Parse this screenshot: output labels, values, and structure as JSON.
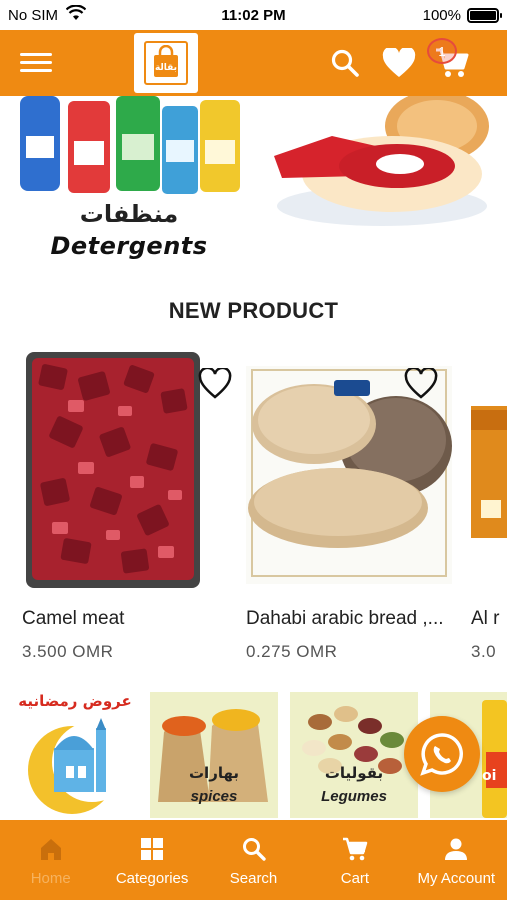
{
  "status_bar": {
    "carrier": "No SIM",
    "time": "11:02 PM",
    "battery": "100%",
    "battery_level": 1.0
  },
  "header": {
    "menu_icon": "hamburger-menu-icon",
    "search_icon": "search-icon",
    "favorites_icon": "heart-icon",
    "cart_icon": "cart-icon",
    "cart_count": "1"
  },
  "categories": [
    {
      "label_ar": "منظفات",
      "label_en": "Detergents"
    },
    {
      "label_ar": "",
      "label_en": ""
    }
  ],
  "section_title": "NEW PRODUCT",
  "products": [
    {
      "name": "Camel meat",
      "price": "3.500 OMR"
    },
    {
      "name": "Dahabi arabic bread ,...",
      "price": "0.275 OMR"
    },
    {
      "name": "Al r",
      "price": "3.0"
    }
  ],
  "offers": [
    {
      "label_ar": "عروض رمضانيه",
      "label_en": ""
    },
    {
      "label_ar": "بهارات",
      "label_en": "spices"
    },
    {
      "label_ar": "بقوليات",
      "label_en": "Legumes"
    },
    {
      "label_ar": "oi",
      "label_en": ""
    }
  ],
  "bottom_nav": [
    {
      "label": "Home",
      "icon": "home-icon",
      "active": true
    },
    {
      "label": "Categories",
      "icon": "grid-icon",
      "active": false
    },
    {
      "label": "Search",
      "icon": "search-icon",
      "active": false
    },
    {
      "label": "Cart",
      "icon": "cart-icon",
      "active": false
    },
    {
      "label": "My Account",
      "icon": "person-icon",
      "active": false
    }
  ],
  "colors": {
    "brand_orange": "#ef8a12",
    "badge_red": "#e64b3c",
    "active_nav": "#f6b25e"
  }
}
